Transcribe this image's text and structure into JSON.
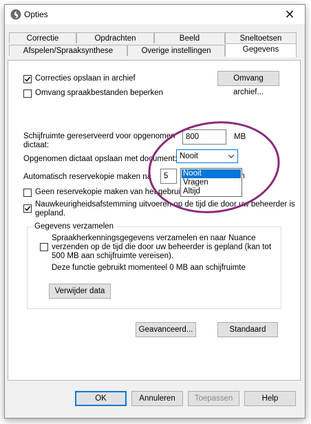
{
  "window": {
    "title": "Opties",
    "close_glyph": "✕"
  },
  "tabs": {
    "row1": [
      "Correctie",
      "Opdrachten",
      "Beeld",
      "Sneltoetsen"
    ],
    "row2": [
      "Afspelen/Spraaksynthese",
      "Overige instellingen",
      "Gegevens"
    ],
    "active": "Gegevens"
  },
  "checkboxes": {
    "save_corrections": {
      "label": "Correcties opslaan in archief",
      "checked": true
    },
    "limit_speech": {
      "label": "Omvang spraakbestanden beperken",
      "checked": false
    },
    "no_backup": {
      "label": "Geen reservekopie maken van het gebruikersprofiel",
      "checked": false
    },
    "accuracy_tuning": {
      "label_line1": "Nauwkeurigheidsafstemming uitvoeren op de tijd die door uw beheerder is",
      "label_line2": "gepland.",
      "checked": true
    },
    "collect_data": {
      "label_line1": "Spraakherkenningsgegevens verzamelen en naar Nuance",
      "label_line2": "verzenden op de tijd die door uw beheerder is gepland (kan tot",
      "label_line3": "500 MB aan schijfruimte vereisen).",
      "checked": false
    }
  },
  "buttons": {
    "archive_size": "Omvang archief...",
    "delete_data": "Verwijder data",
    "advanced": "Geavanceerd...",
    "default": "Standaard",
    "ok": "OK",
    "cancel": "Annuleren",
    "apply": "Toepassen",
    "help": "Help"
  },
  "disk_space": {
    "label_line1": "Schijfruimte gereserveerd voor opgenomen",
    "label_line2": "dictaat:",
    "value": "800",
    "unit": "MB"
  },
  "save_dictation": {
    "label": "Opgenomen dictaat opslaan met document:",
    "selected": "Nooit",
    "options": [
      "Nooit",
      "Vragen",
      "Altijd"
    ]
  },
  "backup": {
    "label": "Automatisch reservekopie maken na",
    "value": "5",
    "suffix_partial": "an"
  },
  "group": {
    "title": "Gegevens verzamelen",
    "info": "Deze functie gebruikt momenteel 0 MB aan schijfruimte"
  },
  "colors": {
    "selection": "#0078d7",
    "annotation": "#8b2a7a"
  }
}
